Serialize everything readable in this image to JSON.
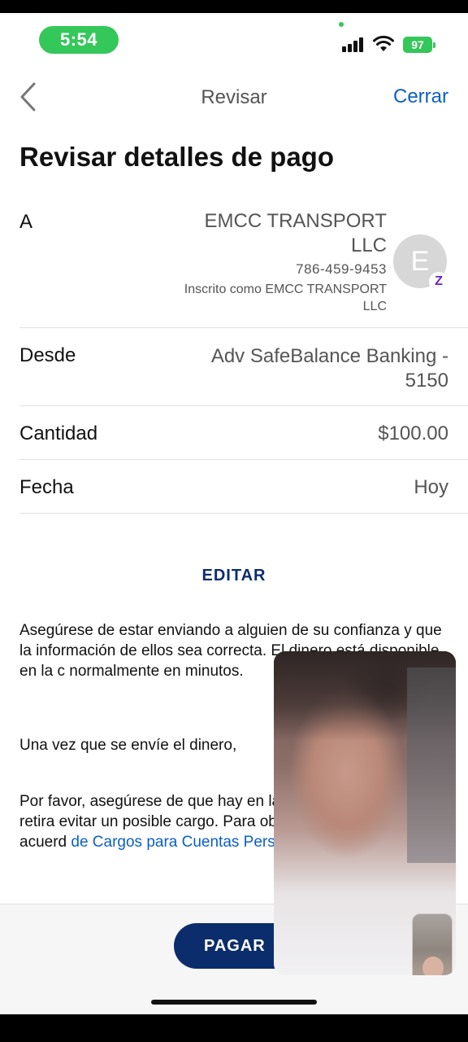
{
  "status": {
    "time": "5:54",
    "battery": "97"
  },
  "nav": {
    "title": "Revisar",
    "close": "Cerrar"
  },
  "page_title": "Revisar detalles de pago",
  "to": {
    "label": "A",
    "name": "EMCC TRANSPORT LLC",
    "phone": "786-459-9453",
    "enrolled": "Inscrito como EMCC TRANSPORT LLC",
    "avatar_letter": "E",
    "badge": "Z"
  },
  "from": {
    "label": "Desde",
    "value": "Adv SafeBalance Banking - 5150"
  },
  "amount": {
    "label": "Cantidad",
    "value": "$100.00"
  },
  "date": {
    "label": "Fecha",
    "value": "Hoy"
  },
  "edit": "EDITAR",
  "disclaimer": {
    "p1": "Asegúrese de estar enviando a alguien de su confianza y que la información de ellos sea correcta. El dinero está disponible en la c normalmente en minutos.",
    "p2": "Una vez que se envíe el dinero,",
    "p3": "Por favor, asegúrese de que hay en la cuenta de la que va a retira evitar un posible cargo. Para ob información, consulte su acuerd",
    "p3_link": "de Cargos para Cuentas Person"
  },
  "pay_button": "PAGAR",
  "colors": {
    "accent": "#0b5fc7",
    "navy": "#0b2d6b",
    "status_green": "#34c759"
  }
}
